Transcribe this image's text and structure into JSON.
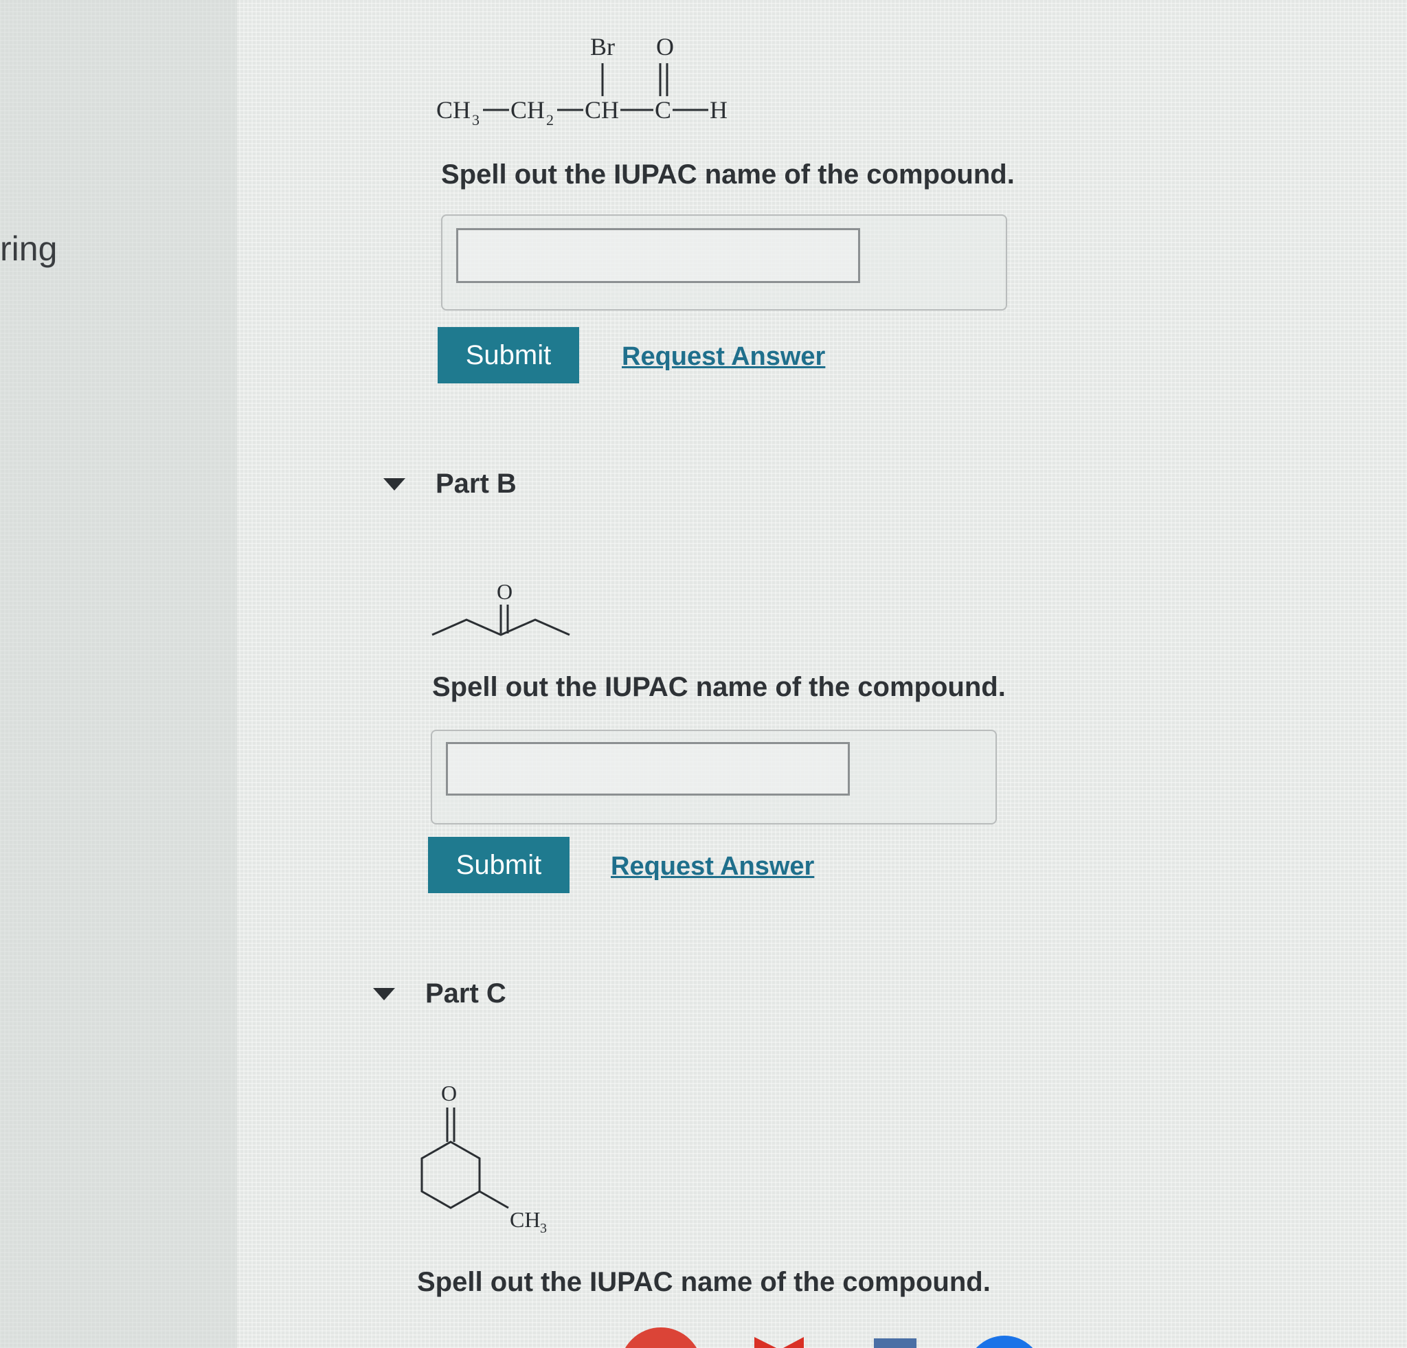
{
  "sidebar": {
    "text": "ring"
  },
  "partA": {
    "structure": {
      "ch3": "CH",
      "ch3_sub": "3",
      "ch2": "CH",
      "ch2_sub": "2",
      "ch": "CH",
      "c": "C",
      "h": "H",
      "br": "Br",
      "o": "O"
    },
    "prompt": "Spell out the IUPAC name of the compound.",
    "answer_value": "",
    "submit_label": "Submit",
    "request_label": "Request Answer"
  },
  "partB": {
    "title": "Part B",
    "structure": {
      "o": "O"
    },
    "prompt": "Spell out the IUPAC name of the compound.",
    "answer_value": "",
    "submit_label": "Submit",
    "request_label": "Request Answer"
  },
  "partC": {
    "title": "Part C",
    "structure": {
      "o": "O",
      "ch3": "CH",
      "ch3_sub": "3"
    },
    "prompt": "Spell out the IUPAC name of the compound."
  },
  "colors": {
    "submit_bg": "#1f7a8f",
    "link": "#1f6f8c"
  }
}
